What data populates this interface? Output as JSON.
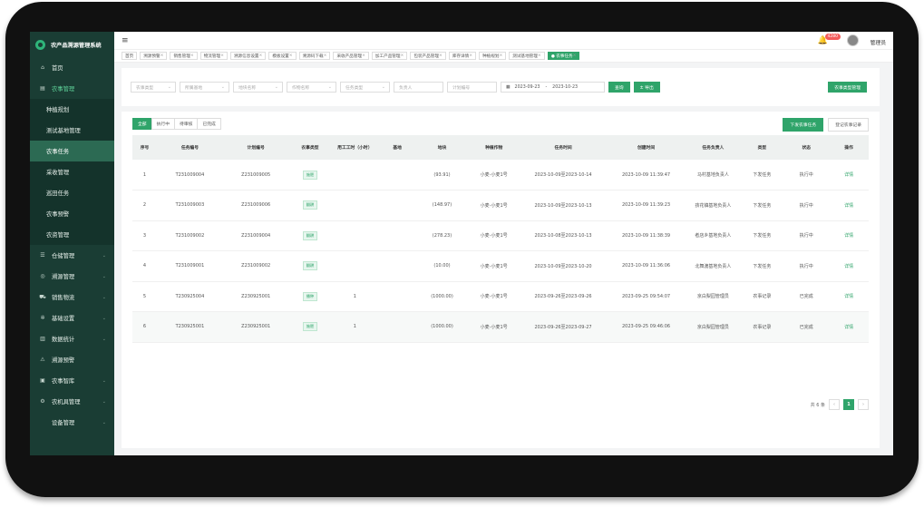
{
  "app": {
    "title": "农产品溯源管理系统"
  },
  "user": {
    "name": "管理员",
    "badge": "4280"
  },
  "sidebar": {
    "items": [
      {
        "label": "首页",
        "icon": "home-icon",
        "sub": false
      },
      {
        "label": "农事管理",
        "icon": "document-icon",
        "sub": false,
        "active": true
      },
      {
        "label": "种植规划",
        "icon": "",
        "sub": true
      },
      {
        "label": "测试基地管理",
        "icon": "",
        "sub": true
      },
      {
        "label": "农事任务",
        "icon": "",
        "sub": true,
        "active": true
      },
      {
        "label": "采收管理",
        "icon": "",
        "sub": true
      },
      {
        "label": "巡田任务",
        "icon": "",
        "sub": true
      },
      {
        "label": "农事预警",
        "icon": "",
        "sub": true
      },
      {
        "label": "农资管理",
        "icon": "",
        "sub": true
      },
      {
        "label": "仓储管理",
        "icon": "list-icon",
        "sub": false,
        "chev": true
      },
      {
        "label": "溯源管理",
        "icon": "trace-icon",
        "sub": false,
        "chev": true
      },
      {
        "label": "销售物流",
        "icon": "cart-icon",
        "sub": false,
        "chev": true
      },
      {
        "label": "基础设置",
        "icon": "gear-icon",
        "sub": false,
        "chev": true
      },
      {
        "label": "数据统计",
        "icon": "chart-icon",
        "sub": false,
        "chev": true
      },
      {
        "label": "溯源预警",
        "icon": "warning-icon",
        "sub": false
      },
      {
        "label": "农事智库",
        "icon": "book-icon",
        "sub": false,
        "chev": true
      },
      {
        "label": "农机具管理",
        "icon": "tool-icon",
        "sub": false,
        "chev": true
      },
      {
        "label": "设备管理",
        "icon": "",
        "sub": false,
        "chev": true
      }
    ]
  },
  "tabs": [
    "首页",
    "溯源预警",
    "销售管理",
    "物流管理",
    "溯源信息设置",
    "模板设置",
    "溯源码下载",
    "采收产品管理",
    "加工产品管理",
    "包装产品管理",
    "库存详情",
    "种植规划",
    "测试基地管理",
    "● 农事任务"
  ],
  "filter": {
    "farm_type": "农事类型",
    "base": "所属基地",
    "plot": "地块名称",
    "crop": "作物名称",
    "task_type": "任务类型",
    "owner": "负责人",
    "plan_no": "计划编号",
    "date_start": "2023-09-23",
    "date_sep": "-",
    "date_end": "2023-10-23",
    "search": "查询",
    "export": "± 导出",
    "type_manage": "农事类型管理"
  },
  "status_tabs": [
    "全部",
    "执行中",
    "待审核",
    "已完成"
  ],
  "actions": {
    "issue": "下发农事任务",
    "register": "登记农事记录"
  },
  "table": {
    "headers": [
      "序号",
      "任务编号",
      "计划编号",
      "农事类型",
      "用工工时（小时）",
      "基地",
      "地块",
      "种植作物",
      "任务时间",
      "创建时间",
      "任务负责人",
      "类型",
      "状态",
      "操作"
    ],
    "rows": [
      [
        "1",
        "T231009004",
        "Z231009005",
        "施肥",
        "",
        "",
        "(93.91)",
        "小麦-小麦1号",
        "2023-10-09至2023-10-14",
        "2023-10-09 11:39:47",
        "马村基地负责人",
        "下发任务",
        "执行中",
        "详情"
      ],
      [
        "2",
        "T231009003",
        "Z231009006",
        "翻耕",
        "",
        "",
        "(148.97)",
        "小麦-小麦1号",
        "2023-10-09至2023-10-13",
        "2023-10-09 11:39:23",
        "孩花镇基地负责人",
        "下发任务",
        "执行中",
        "详情"
      ],
      [
        "3",
        "T231009002",
        "Z231009004",
        "翻耕",
        "",
        "",
        "(278.23)",
        "小麦-小麦1号",
        "2023-10-08至2023-10-13",
        "2023-10-09 11:38:39",
        "者店乡基地负责人",
        "下发任务",
        "执行中",
        "详情"
      ],
      [
        "4",
        "T231009001",
        "Z231009002",
        "翻耕",
        "",
        "",
        "(10.00)",
        "小麦-小麦1号",
        "2023-10-09至2023-10-20",
        "2023-10-09 11:36:06",
        "北舞渡基地负责人",
        "下发任务",
        "执行中",
        "详情"
      ],
      [
        "5",
        "T230925004",
        "Z230925001",
        "播种",
        "1",
        "",
        "(1000.00)",
        "小麦-小麦1号",
        "2023-09-26至2023-09-26",
        "2023-09-25 09:54:07",
        "京白梨园管理员",
        "农事记录",
        "已完成",
        "详情"
      ],
      [
        "6",
        "T230925001",
        "Z230925001",
        "施肥",
        "1",
        "",
        "(1000.00)",
        "小麦-小麦1号",
        "2023-09-26至2023-09-27",
        "2023-09-25 09:46:06",
        "京白梨园管理员",
        "农事记录",
        "已完成",
        "详情"
      ]
    ]
  },
  "pagination": {
    "total": "共 6 条",
    "page": "1",
    "prev": "‹",
    "next": "›"
  }
}
